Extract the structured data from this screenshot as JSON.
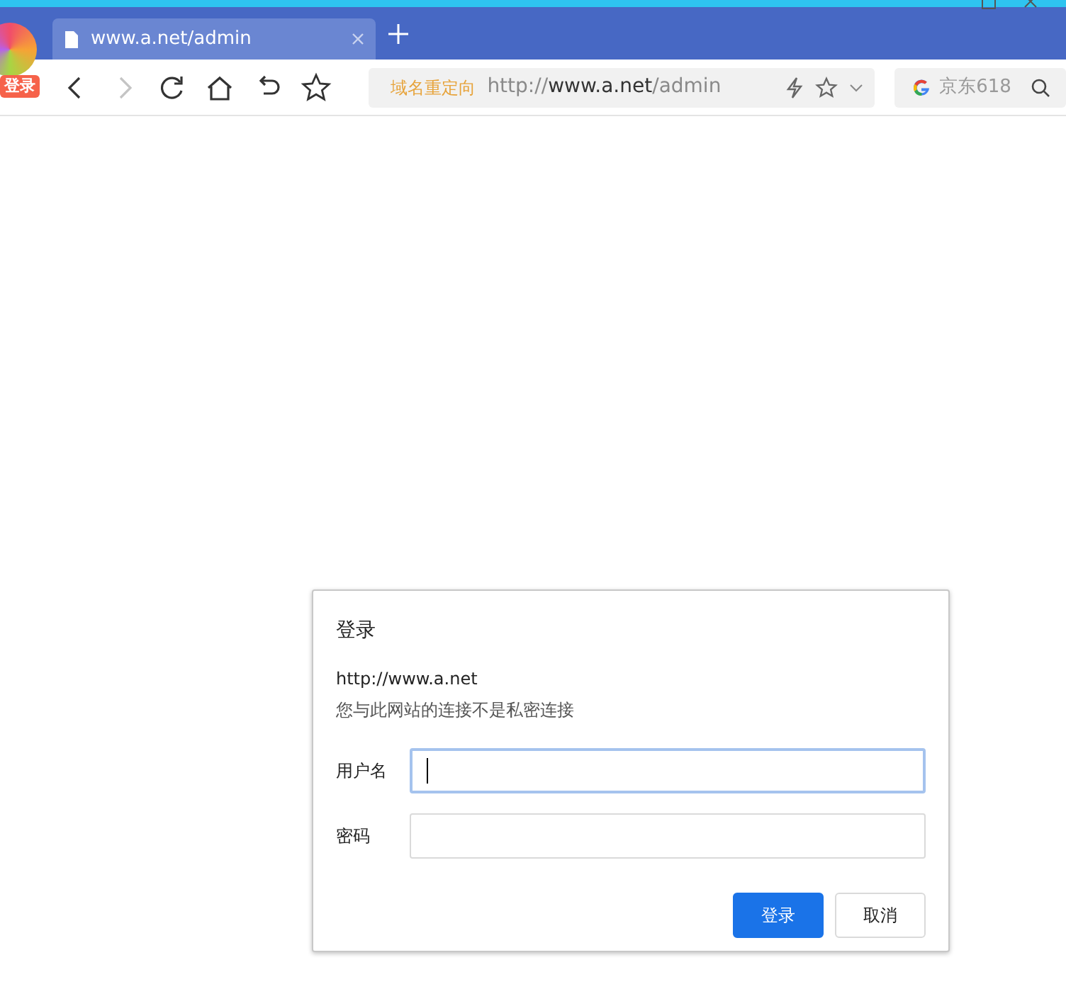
{
  "tabs": [
    {
      "title": "www.a.net/admin",
      "selected": true
    }
  ],
  "account": {
    "badge": "登录"
  },
  "toolbar": {
    "back_disabled": false,
    "forward_disabled": true
  },
  "address_bar": {
    "redirect_label": "域名重定向",
    "url_scheme": "http://",
    "url_host": "www.a.net",
    "url_path": "/admin"
  },
  "search": {
    "placeholder": "京东618"
  },
  "dialog": {
    "title": "登录",
    "origin": "http://www.a.net",
    "warning": "您与此网站的连接不是私密连接",
    "fields": [
      {
        "label": "用户名",
        "focused": true
      },
      {
        "label": "密码",
        "focused": false
      }
    ],
    "buttons": [
      {
        "label": "登录",
        "kind": "primary"
      },
      {
        "label": "取消",
        "kind": "secondary"
      }
    ]
  }
}
